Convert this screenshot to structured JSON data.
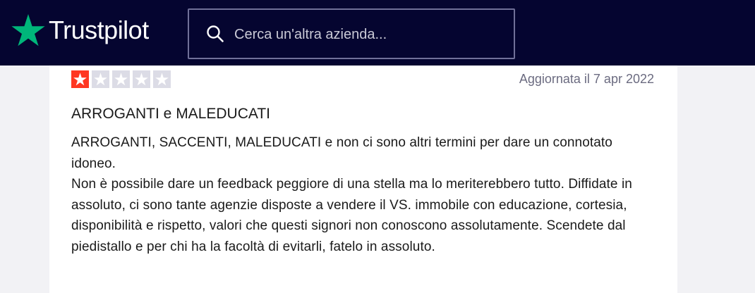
{
  "header": {
    "logo_text": "Trustpilot",
    "brand_color": "#00b67a",
    "background": "#050530"
  },
  "search": {
    "placeholder": "Cerca un'altra azienda...",
    "icon": "search-icon"
  },
  "review": {
    "rating": 1,
    "max_rating": 5,
    "star_color_active": "#ff3722",
    "star_color_inactive": "#dcdce6",
    "date": "Aggiornata il 7 apr 2022",
    "title": "ARROGANTI e MALEDUCATI",
    "paragraphs": [
      "ARROGANTI, SACCENTI, MALEDUCATI e non ci sono altri termini per dare un connotato idoneo.",
      "Non è possibile dare un feedback peggiore di una stella ma lo meriterebbero tutto. Diffidate in assoluto, ci sono tante agenzie disposte a vendere il VS. immobile con educazione, cortesia, disponibilità e rispetto, valori che questi signori non conoscono assolutamente. Scendete dal piedistallo e per chi ha la facoltà di evitarli, fatelo in assoluto."
    ]
  }
}
